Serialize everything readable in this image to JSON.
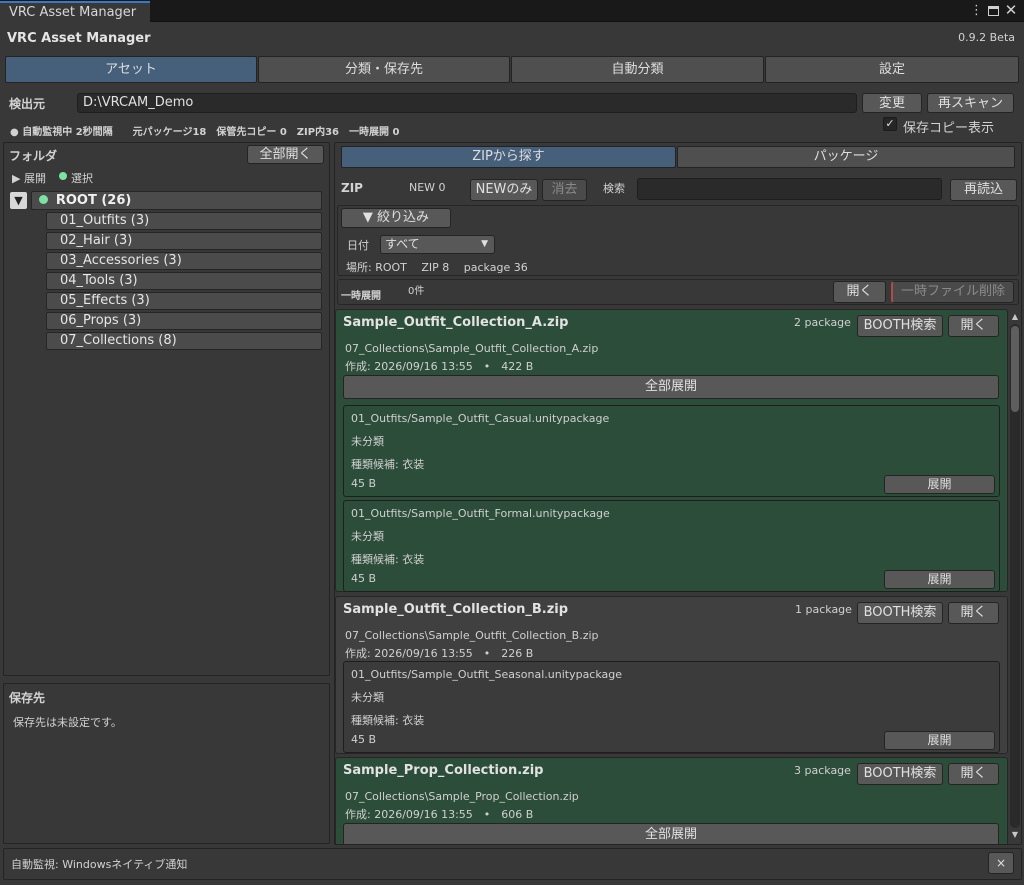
{
  "window": {
    "tab_title": "VRC Asset Manager",
    "app_title": "VRC Asset Manager",
    "version": "0.9.2 Beta"
  },
  "tabs": [
    {
      "label": "アセット",
      "active": true
    },
    {
      "label": "分類・保存先"
    },
    {
      "label": "自動分類"
    },
    {
      "label": "設定"
    }
  ],
  "source": {
    "label": "検出元",
    "path": "D:\\VRCAM_Demo",
    "change_label": "変更",
    "rescan_label": "再スキャン",
    "stats": "● 自動監視中 2秒間隔　　元パッケージ18　保管先コピー 0　ZIP内36　一時展開 0",
    "show_copy_label": "保存コピー表示",
    "show_copy_checked": true
  },
  "folder": {
    "title": "フォルダ",
    "expand_all_label": "全部開く",
    "legend_expand": "▶ 展開",
    "legend_select": "選択",
    "root": {
      "label": "ROOT (26)"
    },
    "items": [
      "01_Outfits (3)",
      "02_Hair (3)",
      "03_Accessories (3)",
      "04_Tools (3)",
      "05_Effects (3)",
      "06_Props (3)",
      "07_Collections (8)"
    ]
  },
  "dest": {
    "title": "保存先",
    "message": "保存先は未設定です。"
  },
  "subtabs": [
    {
      "label": "ZIPから探す",
      "active": true
    },
    {
      "label": "パッケージ"
    }
  ],
  "zip": {
    "label": "ZIP",
    "new_count": "NEW 0",
    "new_only_label": "NEWのみ",
    "clear_label": "消去",
    "search_label": "検索",
    "search_value": "",
    "reload_label": "再読込"
  },
  "filter": {
    "toggle_label": "▼ 絞り込み",
    "date_label": "日付",
    "date_value": "すべて",
    "summary": "場所: ROOT　 ZIP 8　 package 36"
  },
  "temp": {
    "label": "一時展開",
    "count": "0件",
    "open_label": "開く",
    "delete_label": "一時ファイル削除"
  },
  "cards": [
    {
      "title": "Sample_Outfit_Collection_A.zip",
      "count": "2 package",
      "booth_label": "BOOTH検索",
      "open_label": "開く",
      "path": "07_Collections\\Sample_Outfit_Collection_A.zip",
      "meta": "作成: 2026/09/16 13:55　•　422 B",
      "expand_all_label": "全部展開",
      "packages": [
        {
          "name": "01_Outfits/Sample_Outfit_Casual.unitypackage",
          "category": "未分類",
          "type": "種類候補: 衣装",
          "size": "45 B",
          "expand_label": "展開"
        },
        {
          "name": "01_Outfits/Sample_Outfit_Formal.unitypackage",
          "category": "未分類",
          "type": "種類候補: 衣装",
          "size": "45 B",
          "expand_label": "展開"
        }
      ]
    },
    {
      "title": "Sample_Outfit_Collection_B.zip",
      "count": "1 package",
      "booth_label": "BOOTH検索",
      "open_label": "開く",
      "path": "07_Collections\\Sample_Outfit_Collection_B.zip",
      "meta": "作成: 2026/09/16 13:55　•　226 B",
      "packages": [
        {
          "name": "01_Outfits/Sample_Outfit_Seasonal.unitypackage",
          "category": "未分類",
          "type": "種類候補: 衣装",
          "size": "45 B",
          "expand_label": "展開"
        }
      ]
    },
    {
      "title": "Sample_Prop_Collection.zip",
      "count": "3 package",
      "booth_label": "BOOTH検索",
      "open_label": "開く",
      "path": "07_Collections\\Sample_Prop_Collection.zip",
      "meta": "作成: 2026/09/16 13:55　•　606 B",
      "expand_all_label": "全部展開"
    }
  ],
  "status": {
    "text": "自動監視: Windowsネイティブ通知",
    "close_label": "×"
  },
  "colors": {
    "accent": "#46607c",
    "card_green": "#2b4d39",
    "dot": "#7ee0a3",
    "tab_highlight": "#3a78c3"
  }
}
